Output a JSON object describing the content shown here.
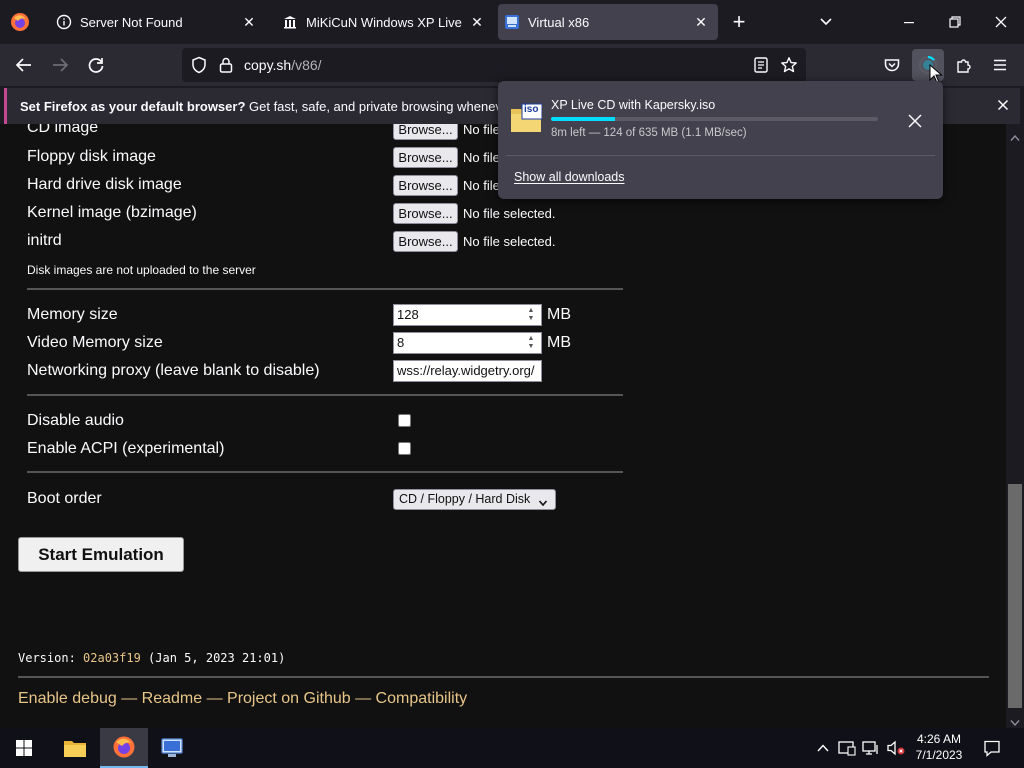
{
  "tabs": [
    {
      "title": "Server Not Found"
    },
    {
      "title": "MiKiCuN Windows XP Live CD ·"
    },
    {
      "title": "Virtual x86"
    }
  ],
  "toolbar": {
    "url_host": "copy.sh",
    "url_path": "/v86/"
  },
  "notification": {
    "bold": "Set Firefox as your default browser?",
    "text": " Get fast, safe, and private browsing whenever you us"
  },
  "page": {
    "partial_label": "CD image",
    "partial_browse": "Browse...",
    "partial_nofile": "No file",
    "rows": [
      {
        "label": "Floppy disk image",
        "browse": "Browse...",
        "status": "No file"
      },
      {
        "label": "Hard drive disk image",
        "browse": "Browse...",
        "status": "No file"
      },
      {
        "label": "Kernel image (bzimage)",
        "browse": "Browse...",
        "status": "No file selected."
      },
      {
        "label": "initrd",
        "browse": "Browse...",
        "status": "No file selected."
      }
    ],
    "disk_note": "Disk images are not uploaded to the server",
    "memory_label": "Memory size",
    "memory_value": "128",
    "memory_unit": "MB",
    "vmem_label": "Video Memory size",
    "vmem_value": "8",
    "vmem_unit": "MB",
    "proxy_label": "Networking proxy (leave blank to disable)",
    "proxy_value": "wss://relay.widgetry.org/",
    "audio_label": "Disable audio",
    "acpi_label": "Enable ACPI (experimental)",
    "boot_label": "Boot order",
    "boot_value": "CD / Floppy / Hard Disk",
    "start_label": "Start Emulation",
    "version_prefix": "Version: ",
    "version_hash": "02a03f19",
    "version_date": " (Jan 5, 2023 21:01)",
    "footer_links": [
      "Enable debug",
      "Readme",
      "Project on Github",
      "Compatibility"
    ],
    "footer_sep": " — "
  },
  "downloads": {
    "file_name": "XP Live CD with Kapersky.iso",
    "progress": 0.195,
    "status": "8m left — 124 of 635 MB (1.1 MB/sec)",
    "show_all": "Show all downloads",
    "icon_label": "iso"
  },
  "taskbar": {
    "time": "4:26 AM",
    "date": "7/1/2023"
  },
  "colors": {
    "accent": "#00ddff",
    "link": "#e8c689",
    "notif_border": "#c4488f"
  }
}
